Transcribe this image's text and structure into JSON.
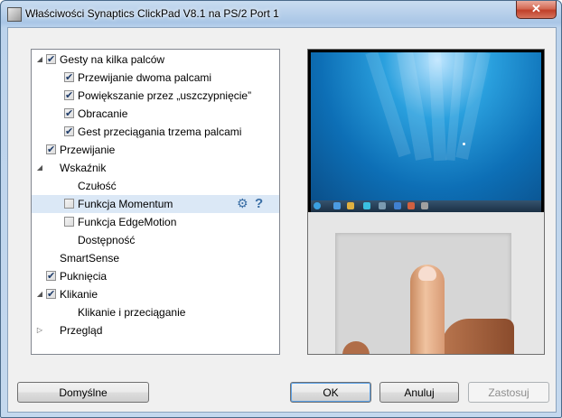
{
  "window": {
    "title": "Właściwości Synaptics ClickPad V8.1 na PS/2 Port 1",
    "close_glyph": "✕"
  },
  "tree": {
    "items": [
      {
        "label": "Gesty na kilka palców",
        "checkbox": true,
        "checked": true,
        "expander": "expanded"
      },
      {
        "label": "Przewijanie dwoma palcami",
        "checkbox": true,
        "checked": true
      },
      {
        "label": "Powiększanie przez „uszczypnięcie”",
        "checkbox": true,
        "checked": true
      },
      {
        "label": "Obracanie",
        "checkbox": true,
        "checked": true
      },
      {
        "label": "Gest przeciągania trzema palcami",
        "checkbox": true,
        "checked": true
      },
      {
        "label": "Przewijanie",
        "checkbox": true,
        "checked": true
      },
      {
        "label": "Wskaźnik",
        "checkbox": false,
        "expander": "expanded"
      },
      {
        "label": "Czułość",
        "checkbox": false
      },
      {
        "label": "Funkcja Momentum",
        "checkbox": true,
        "checked": false,
        "selected": true
      },
      {
        "label": "Funkcja EdgeMotion",
        "checkbox": true,
        "checked": false
      },
      {
        "label": "Dostępność",
        "checkbox": false
      },
      {
        "label": "SmartSense",
        "checkbox": false
      },
      {
        "label": "Puknięcia",
        "checkbox": true,
        "checked": true
      },
      {
        "label": "Klikanie",
        "checkbox": true,
        "checked": true,
        "expander": "expanded"
      },
      {
        "label": "Klikanie i przeciąganie",
        "checkbox": false
      },
      {
        "label": "Przegląd",
        "checkbox": false,
        "expander": "collapsed"
      }
    ],
    "settings_icon": "gear-icon",
    "help_icon": "help-icon",
    "help_glyph": "?"
  },
  "buttons": {
    "defaults": "Domyślne",
    "ok": "OK",
    "cancel": "Anuluj",
    "apply": "Zastosuj"
  },
  "colors": {
    "selection": "#dbe8f6",
    "accent": "#3a6ea5"
  }
}
